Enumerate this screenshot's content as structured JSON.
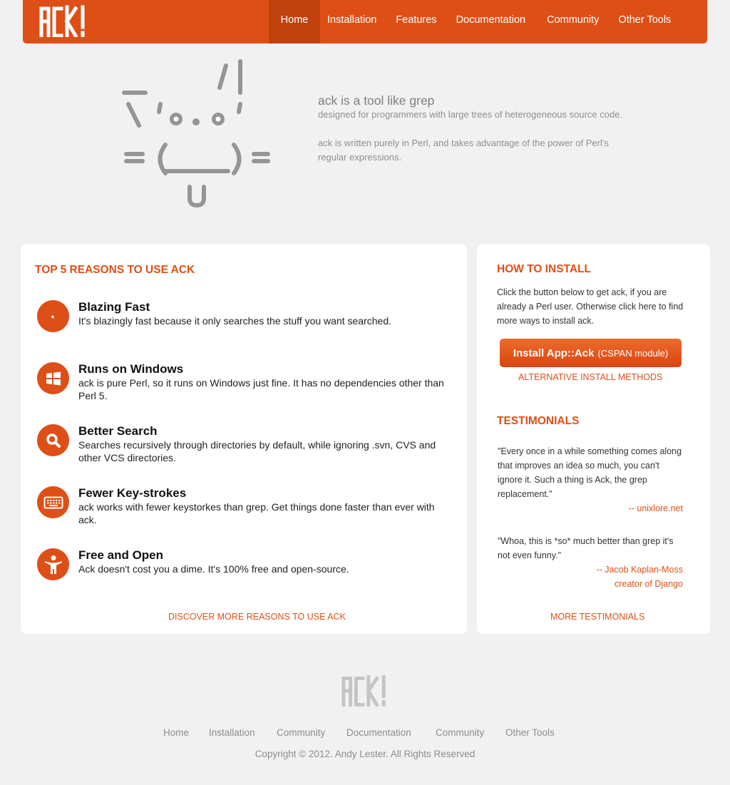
{
  "brand": {
    "logo_text": "ACK!",
    "accent_color": "#de4f17"
  },
  "nav": {
    "items": [
      {
        "label": "Home",
        "active": true
      },
      {
        "label": "Installation",
        "active": false
      },
      {
        "label": "Features",
        "active": false
      },
      {
        "label": "Documentation",
        "active": false
      },
      {
        "label": "Community",
        "active": false
      },
      {
        "label": "Other Tools",
        "active": false
      }
    ]
  },
  "hero": {
    "title": "ack is a tool like grep",
    "line1": "designed for programmers with large trees of heterogeneous source code.",
    "line2": "ack is written purely in Perl, and takes advantage of the power of Perl's regular expressions."
  },
  "reasons": {
    "heading": "TOP 5 REASONS TO USE ACK",
    "items": [
      {
        "title": "Blazing Fast",
        "desc": "It's blazingly fast because it only searches the stuff you want searched.",
        "icon": "lightning-icon"
      },
      {
        "title": "Runs on Windows",
        "desc": "ack is pure Perl, so it runs on Windows just fine. It has no dependencies other than Perl 5.",
        "icon": "windows-icon"
      },
      {
        "title": "Better Search",
        "desc": "Searches recursively through directories by default, while ignoring .svn, CVS and other VCS directories.",
        "icon": "search-icon"
      },
      {
        "title": "Fewer Key-strokes",
        "desc": "ack works with fewer keystorkes than grep. Get things done faster than ever with ack.",
        "icon": "keyboard-icon"
      },
      {
        "title": "Free and Open",
        "desc": "Ack doesn't cost you a dime. It's 100% free and open-source.",
        "icon": "person-icon"
      }
    ],
    "more_link": "DISCOVER MORE REASONS TO USE ACK"
  },
  "install": {
    "heading": "HOW TO INSTALL",
    "desc": "Click the button below to get ack, if you are already a Perl user. Otherwise click here to find more ways to install ack.",
    "button_main": "Install App::Ack",
    "button_sub": "(CSPAN module)",
    "alt_link": "ALTERNATIVE INSTALL METHODS"
  },
  "testimonials": {
    "heading": "TESTIMONIALS",
    "items": [
      {
        "quote": "\"Every once in a while something comes along that improves an idea so much, you can't ignore it. Such a thing is Ack, the grep replacement.\"",
        "author": "-- unixlore.net",
        "role": ""
      },
      {
        "quote": "\"Whoa, this is *so* much better than grep it's not even funny.\"",
        "author": "-- Jacob Kaplan-Moss",
        "role": "creator of Django"
      }
    ],
    "more_link": "MORE TESTIMONIALS"
  },
  "footer": {
    "logo_text": "ACK!",
    "links": [
      "Home",
      "Installation",
      "Community",
      "Documentation",
      "Community",
      "Other Tools"
    ],
    "copyright": "Copyright © 2012. Andy Lester. All Rights Reserved"
  }
}
